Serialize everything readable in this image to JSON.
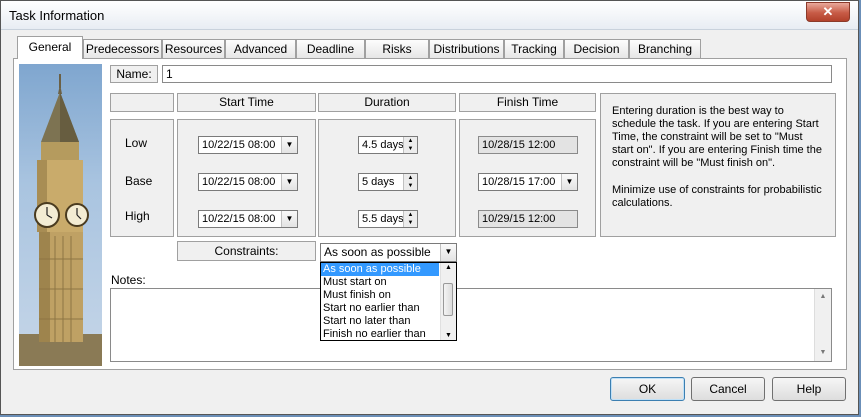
{
  "window": {
    "title": "Task Information",
    "close_symbol": "✕"
  },
  "tabs": [
    "General",
    "Predecessors",
    "Resources",
    "Advanced",
    "Deadline",
    "Risks",
    "Distributions",
    "Tracking",
    "Decision",
    "Branching"
  ],
  "name": {
    "label": "Name:",
    "value": "1"
  },
  "columns": {
    "start": "Start Time",
    "duration": "Duration",
    "finish": "Finish Time"
  },
  "rows": [
    {
      "label": "Low",
      "start": "10/22/15 08:00",
      "duration": "4.5 days",
      "finish": "10/28/15 12:00"
    },
    {
      "label": "Base",
      "start": "10/22/15 08:00",
      "duration": "5 days",
      "finish": "10/28/15 17:00"
    },
    {
      "label": "High",
      "start": "10/22/15 08:00",
      "duration": "5.5 days",
      "finish": "10/29/15 12:00"
    }
  ],
  "info": {
    "para1": "Entering duration is the best way to schedule the task. If you are entering Start Time, the constraint will be set to \"Must start on\". If you are entering Finish time the constraint will be \"Must finish on\".",
    "para2": "Minimize use of constraints for probabilistic calculations."
  },
  "constraints": {
    "label": "Constraints:",
    "selected": "As soon as possible",
    "options": [
      "As soon as possible",
      "Must start on",
      "Must finish on",
      "Start no earlier than",
      "Start no later than",
      "Finish no earlier than"
    ]
  },
  "notes": {
    "label": "Notes:"
  },
  "buttons": {
    "ok": "OK",
    "cancel": "Cancel",
    "help": "Help"
  }
}
